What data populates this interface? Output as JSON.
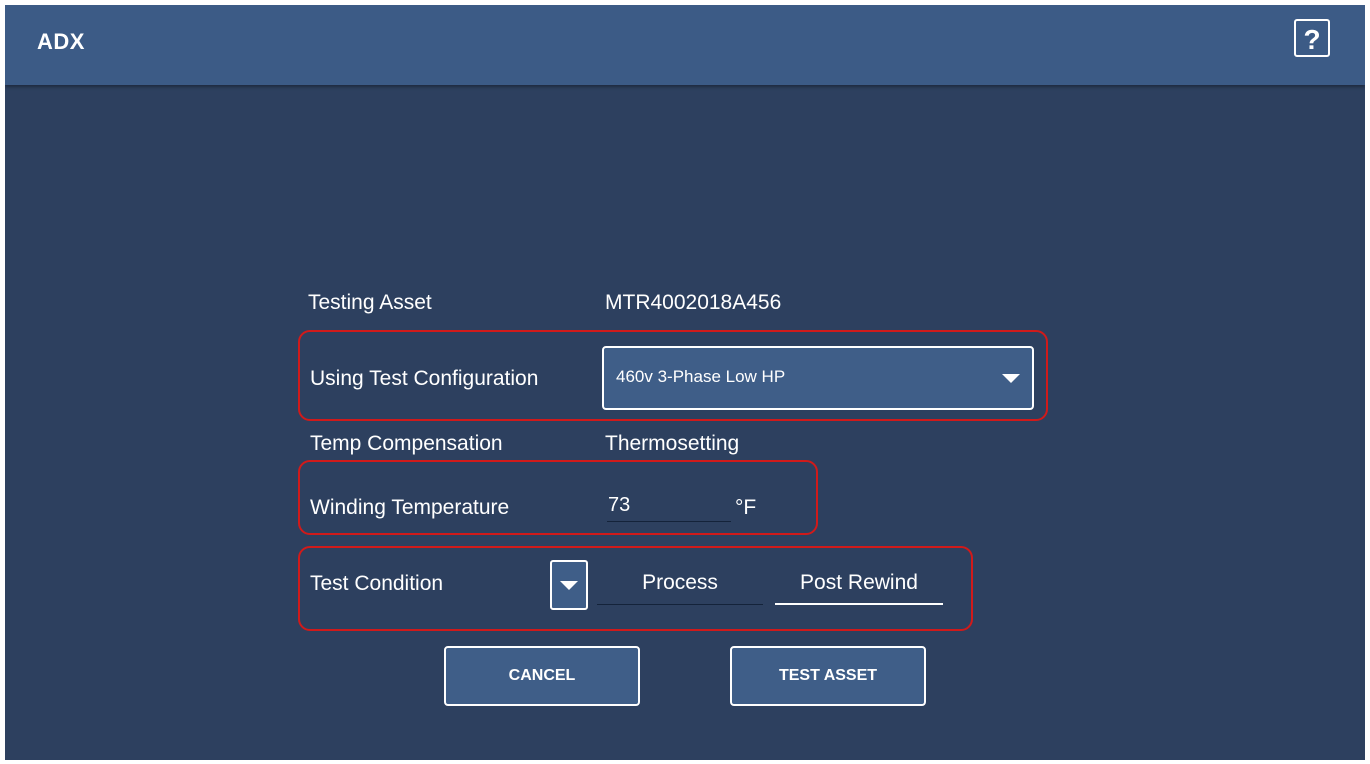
{
  "header": {
    "title": "ADX",
    "help_label": "?"
  },
  "form": {
    "testing_asset": {
      "label": "Testing Asset",
      "value": "MTR4002018A456"
    },
    "test_configuration": {
      "label": "Using Test Configuration",
      "selected": "460v 3-Phase Low HP",
      "icon": "chevron-down-icon"
    },
    "temp_compensation": {
      "label": "Temp Compensation",
      "value": "Thermosetting"
    },
    "winding_temperature": {
      "label": "Winding Temperature",
      "value": "73",
      "unit": "°F"
    },
    "test_condition": {
      "label": "Test Condition",
      "options": [
        "Process",
        "Post Rewind"
      ],
      "selected": "Post Rewind",
      "icon": "chevron-down-icon"
    }
  },
  "buttons": {
    "cancel": "CANCEL",
    "test_asset": "TEST ASSET"
  },
  "colors": {
    "background": "#2d405f",
    "header": "#3c5b86",
    "control": "#3f5e88",
    "highlight": "#d11a1a",
    "text": "#ffffff"
  }
}
